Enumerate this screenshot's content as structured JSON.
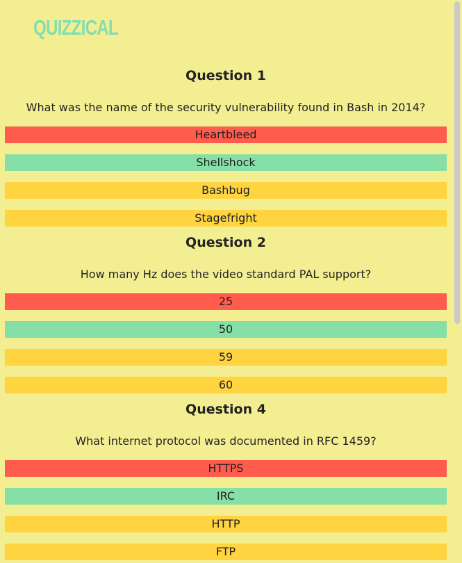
{
  "app": {
    "logo_text": "QUIZZICAL",
    "colors": {
      "background": "#f4ee92",
      "logo": "#86ddae",
      "wrong": "#ff5c4d",
      "correct": "#86dfa6",
      "neutral": "#ffd440"
    }
  },
  "questions": [
    {
      "title": "Question 1",
      "text": "What was the name of the security vulnerability found in Bash in 2014?",
      "answers": [
        {
          "label": "Heartbleed",
          "state": "wrong"
        },
        {
          "label": "Shellshock",
          "state": "correct"
        },
        {
          "label": "Bashbug",
          "state": "neutral"
        },
        {
          "label": "Stagefright",
          "state": "neutral"
        }
      ]
    },
    {
      "title": "Question 2",
      "text": "How many Hz does the video standard PAL support?",
      "answers": [
        {
          "label": "25",
          "state": "wrong"
        },
        {
          "label": "50",
          "state": "correct"
        },
        {
          "label": "59",
          "state": "neutral"
        },
        {
          "label": "60",
          "state": "neutral"
        }
      ]
    },
    {
      "title": "Question 4",
      "text": "What internet protocol was documented in RFC 1459?",
      "answers": [
        {
          "label": "HTTPS",
          "state": "wrong"
        },
        {
          "label": "IRC",
          "state": "correct"
        },
        {
          "label": "HTTP",
          "state": "neutral"
        },
        {
          "label": "FTP",
          "state": "neutral"
        }
      ]
    }
  ]
}
